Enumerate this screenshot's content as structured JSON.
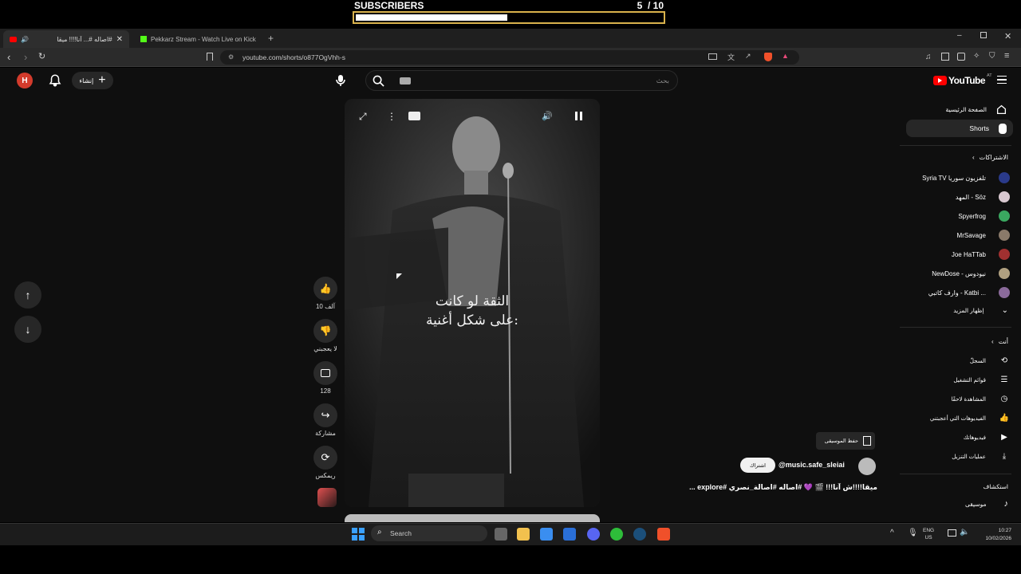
{
  "overlay": {
    "title": "SUBSCRIBERS",
    "current": "5",
    "goal": "/ 10",
    "progress": 0.5
  },
  "browser": {
    "tabs": [
      {
        "label": "#اصاله #... آنا!!!! ميقا"
      },
      {
        "label": "Pekkarz Stream - Watch Live on Kick"
      }
    ],
    "url": "youtube.com/shorts/o877OgVhh-s"
  },
  "youtube": {
    "avatar_letter": "H",
    "create_label": "إنشاء",
    "search_placeholder": "بحث",
    "logo_text": "YouTube",
    "logo_region": "AT",
    "sidebar": {
      "home": "الصفحة الرئيسية",
      "shorts": "Shorts",
      "subscriptions_header": "الاشتراكات",
      "subscriptions": [
        {
          "name": "Syria TV تلفزيون سوريا",
          "color": "#2a3a8a"
        },
        {
          "name": "المهد - Söz",
          "color": "#d8c8d0"
        },
        {
          "name": "Spyerfrog",
          "color": "#3aa860"
        },
        {
          "name": "MrSavage",
          "color": "#8a7a6a"
        },
        {
          "name": "Joe HaTTab",
          "color": "#a03030"
        },
        {
          "name": "NewDose - نيودوس",
          "color": "#b0a080"
        },
        {
          "name": "وارف كاتبي - Katbi ...",
          "color": "#8a6a9a"
        }
      ],
      "show_more": "إظهار المزيد",
      "you_header": "أنت",
      "you_items": [
        "السجلّ",
        "قوائم التشغيل",
        "المشاهدة لاحقًا",
        "الفيديوهات التي أعجبتني",
        "فيديوهاتك",
        "عمليات التنزيل"
      ],
      "explore_header": "استكشاف",
      "explore_items": [
        "موسيقى"
      ]
    },
    "short": {
      "caption_line1": "الثقة لو كانت",
      "caption_line2": "على شكل أغنية:",
      "likes": "10 آلف",
      "dislike": "لا يعجبني",
      "comments": "128",
      "share": "مشاركة",
      "remix": "ريمكس",
      "channel": "@music.safe_sleiai",
      "subscribe": "اشتراك",
      "save_music": "حفظ الموسيقى",
      "title": "ميقا!!!!ش آنا!!! 🎬 💜 #اصاله #اصالة_نصري #explore ..."
    }
  },
  "taskbar": {
    "search": "Search",
    "lang1": "ENG",
    "lang2": "US",
    "time": "10:27",
    "date": "10/02/2026"
  }
}
